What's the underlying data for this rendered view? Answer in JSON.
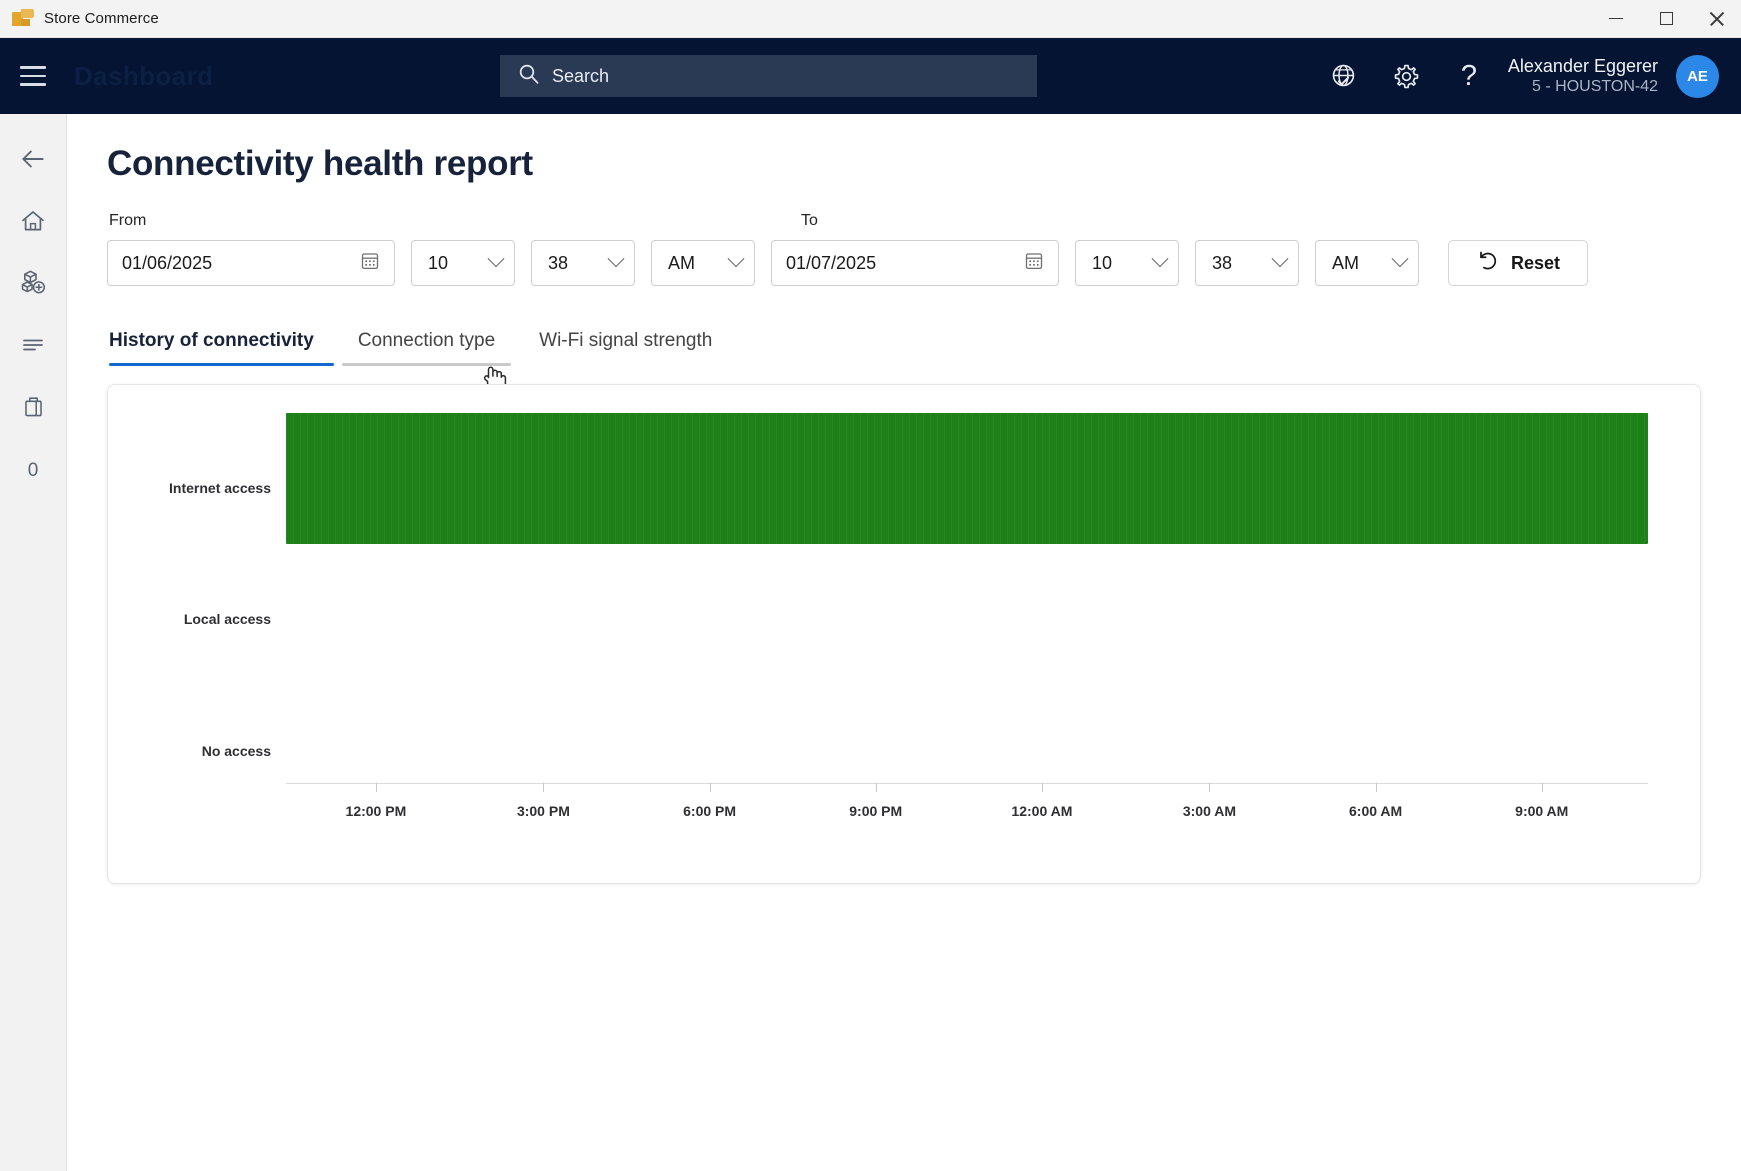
{
  "titlebar": {
    "app_name": "Store Commerce",
    "logo_icon": "folder-flag-icon",
    "minimize_label": "Minimize",
    "maximize_label": "Maximize",
    "close_label": "Close"
  },
  "navbar": {
    "menu_icon": "hamburger-menu-icon",
    "brand": "Dashboard",
    "search": {
      "icon": "search-icon",
      "text": "Search",
      "placeholder": "Search"
    },
    "language_icon": "globe-check-icon",
    "settings_icon": "gear-icon",
    "help_icon": "question-mark-icon",
    "help_glyph": "?",
    "user": {
      "name": "Alexander Eggerer",
      "store": "5 - HOUSTON-42",
      "initials": "AE"
    }
  },
  "sidebar": {
    "items": [
      {
        "name": "back",
        "icon": "back-arrow-icon",
        "label": ""
      },
      {
        "name": "home",
        "icon": "home-icon",
        "label": ""
      },
      {
        "name": "products",
        "icon": "products-cubes-icon",
        "label": ""
      },
      {
        "name": "journal",
        "icon": "list-lines-icon",
        "label": ""
      },
      {
        "name": "cart",
        "icon": "shopping-bag-icon",
        "label": ""
      },
      {
        "name": "count",
        "icon": "zero-count",
        "label": "0"
      }
    ]
  },
  "page": {
    "title": "Connectivity health report"
  },
  "filters": {
    "from_label": "From",
    "to_label": "To",
    "from": {
      "date": "01/06/2025",
      "calendar_icon": "calendar-icon",
      "hour": "10",
      "minute": "38",
      "meridiem": "AM"
    },
    "to": {
      "date": "01/07/2025",
      "calendar_icon": "calendar-icon",
      "hour": "10",
      "minute": "38",
      "meridiem": "AM"
    },
    "reset": {
      "label": "Reset",
      "icon": "undo-arrow-icon"
    }
  },
  "tabs": [
    {
      "label": "History of connectivity",
      "state": "active"
    },
    {
      "label": "Connection type",
      "state": "hovered"
    },
    {
      "label": "Wi-Fi signal strength",
      "state": "default"
    }
  ],
  "chart_data": {
    "type": "bar",
    "title": "",
    "xlabel": "",
    "ylabel": "",
    "categories": [
      "Internet access",
      "Local access",
      "No access"
    ],
    "series": [
      {
        "name": "Internet access",
        "color": "#1d8018",
        "segments": [
          {
            "category": "Internet access",
            "start": "10:38 AM",
            "end": "10:38 AM next day",
            "start_pct": 0,
            "end_pct": 100
          }
        ]
      },
      {
        "name": "Local access",
        "color": "#1d8018",
        "segments": []
      },
      {
        "name": "No access",
        "color": "#c62828",
        "segments": []
      }
    ],
    "values": [
      100,
      0,
      0
    ],
    "x_ticks": [
      "12:00 PM",
      "3:00 PM",
      "6:00 PM",
      "9:00 PM",
      "12:00 AM",
      "3:00 AM",
      "6:00 AM",
      "9:00 AM"
    ],
    "x_tick_positions_pct": [
      6.6,
      18.9,
      31.1,
      43.3,
      55.5,
      67.8,
      80.0,
      92.2
    ],
    "x_range": [
      "10:38 AM 01/06/2025",
      "10:38 AM 01/07/2025"
    ],
    "grid": false,
    "legend": "none"
  },
  "colors": {
    "nav_background": "#041432",
    "accent_blue": "#1367d0",
    "bar_green": "#1d8018",
    "avatar_blue": "#2b88e8"
  }
}
